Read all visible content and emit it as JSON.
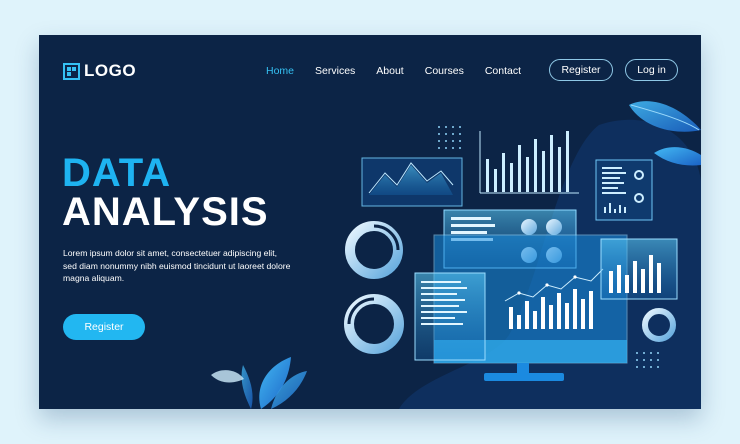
{
  "header": {
    "logo_text": "LOGO",
    "nav": [
      {
        "label": "Home",
        "active": true
      },
      {
        "label": "Services",
        "active": false
      },
      {
        "label": "About",
        "active": false
      },
      {
        "label": "Courses",
        "active": false
      },
      {
        "label": "Contact",
        "active": false
      }
    ],
    "register_label": "Register",
    "login_label": "Log in"
  },
  "hero": {
    "title_line1": "DATA",
    "title_line2": "ANALYSIS",
    "body": "Lorem ipsum dolor sit amet, consectetuer adipiscing elit, sed diam nonummy nibh euismod tincidunt ut laoreet dolore magna aliquam.",
    "cta_label": "Register"
  },
  "colors": {
    "background": "#dff3fb",
    "card": "#0c2446",
    "accent": "#22b7f1",
    "title_accent": "#1eb3f1",
    "text": "#ffffff"
  },
  "icons": [
    "logo-grid-icon",
    "line-chart-icon",
    "bar-chart-icon",
    "donut-chart-icon",
    "dot-grid-icon",
    "monitor-icon",
    "leaf-icon"
  ]
}
